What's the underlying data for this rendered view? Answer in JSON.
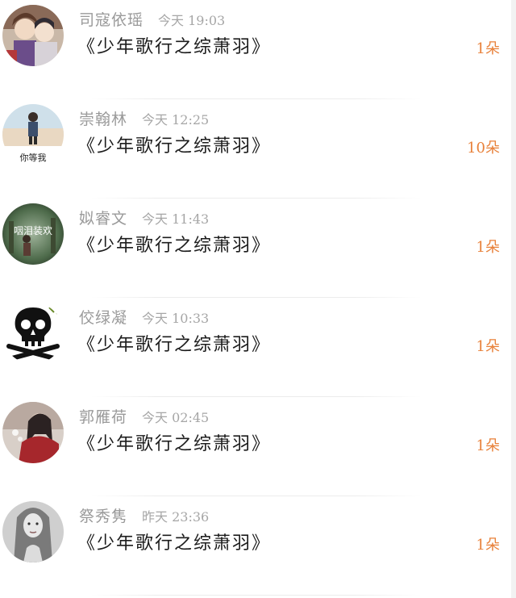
{
  "rows": [
    {
      "name": "司寇依瑶",
      "time": "今天 19:03",
      "title": "《少年歌行之综萧羽》",
      "count": "1朵",
      "avatar_icon": "anime-couple-avatar-icon"
    },
    {
      "name": "崇翰林",
      "time": "今天 12:25",
      "title": "《少年歌行之综萧羽》",
      "count": "10朵",
      "avatar_icon": "beach-person-avatar-icon",
      "avatar_caption": "你等我"
    },
    {
      "name": "姒睿文",
      "time": "今天 11:43",
      "title": "《少年歌行之综萧羽》",
      "count": "1朵",
      "avatar_icon": "forest-figure-avatar-icon",
      "avatar_caption": "咽泪装欢"
    },
    {
      "name": "佼绿凝",
      "time": "今天 10:33",
      "title": "《少年歌行之综萧羽》",
      "count": "1朵",
      "avatar_icon": "skull-crossbones-avatar-icon"
    },
    {
      "name": "郭雁荷",
      "time": "今天 02:45",
      "title": "《少年歌行之综萧羽》",
      "count": "1朵",
      "avatar_icon": "red-scarf-girl-avatar-icon"
    },
    {
      "name": "祭秀隽",
      "time": "昨天 23:36",
      "title": "《少年歌行之综萧羽》",
      "count": "1朵",
      "avatar_icon": "bw-portrait-avatar-icon"
    }
  ],
  "colors": {
    "count": "#e8813a",
    "title": "#1c1c1c",
    "meta": "#9b9b9b"
  }
}
